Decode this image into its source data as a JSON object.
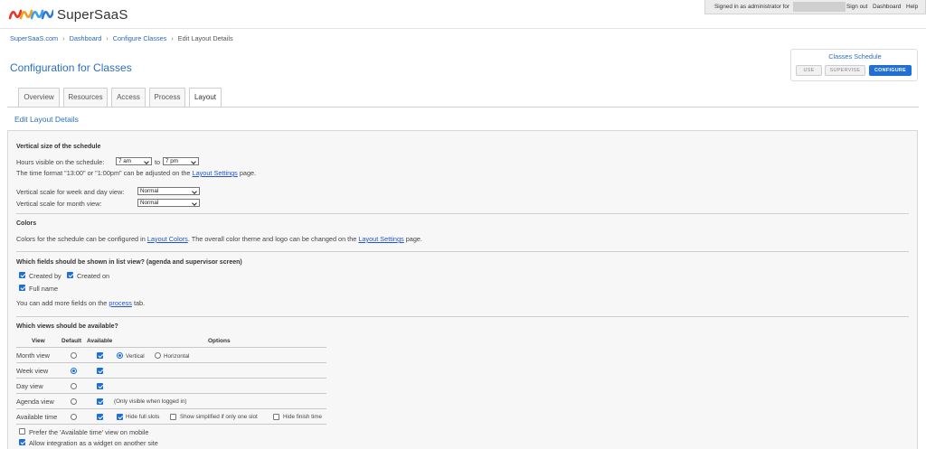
{
  "header": {
    "brand": "SuperSaaS",
    "signed_in": "Signed in as administrator for",
    "sign_out": "Sign out",
    "dashboard": "Dashboard",
    "help": "Help"
  },
  "breadcrumbs": [
    "SuperSaaS.com",
    "Dashboard",
    "Configure Classes",
    "Edit Layout Details"
  ],
  "page_title": "Configuration for Classes",
  "schedule_box": {
    "title": "Classes Schedule",
    "buttons": [
      "USE",
      "SUPERVISE",
      "CONFIGURE"
    ]
  },
  "tabs": [
    "Overview",
    "Resources",
    "Access",
    "Process",
    "Layout"
  ],
  "subheading": "Edit Layout Details",
  "vertical": {
    "heading": "Vertical size of the schedule",
    "hours_label": "Hours visible on the schedule:",
    "hours_from": "7 am",
    "hours_to_label": "to",
    "hours_to": "7 pm",
    "time_note_pre": "The time format \"13:00\" or \"1:00pm\" can be adjusted on the",
    "time_note_link": "Layout Settings",
    "time_note_post": "page.",
    "week_scale_label": "Vertical scale for week and day view:",
    "week_scale_value": "Normal",
    "month_scale_label": "Vertical scale for month view:",
    "month_scale_value": "Normal"
  },
  "colors": {
    "heading": "Colors",
    "pre": "Colors for the schedule can be configured in",
    "link1": "Layout Colors",
    "mid": ". The overall color theme and logo can be changed on the",
    "link2": "Layout Settings",
    "post": "page."
  },
  "fields": {
    "heading": "Which fields should be shown in list view? (agenda and supervisor screen)",
    "created_by": "Created by",
    "created_on": "Created on",
    "full_name": "Full name",
    "more_pre": "You can add more fields on the",
    "more_link": "process",
    "more_post": "tab."
  },
  "views": {
    "heading": "Which views should be available?",
    "columns": [
      "View",
      "Default",
      "Available",
      "Options"
    ],
    "rows": [
      {
        "name": "Month view",
        "default": false,
        "available": true
      },
      {
        "name": "Week view",
        "default": true,
        "available": true
      },
      {
        "name": "Day view",
        "default": false,
        "available": true
      },
      {
        "name": "Agenda view",
        "default": false,
        "available": true
      },
      {
        "name": "Available time",
        "default": false,
        "available": true
      }
    ],
    "month_opt_vertical": "Vertical",
    "month_opt_horizontal": "Horizontal",
    "agenda_note": "(Only visible when logged in)",
    "avail_opt1": "Hide full slots",
    "avail_opt2": "Show simplified if only one slot",
    "avail_opt3": "Hide finish time",
    "prefer_mobile": "Prefer the 'Available time' view on mobile",
    "allow_widget": "Allow integration as a widget on another site"
  },
  "colors_palette": {
    "accent": "#2b6fc2",
    "button": "#1f6fd6",
    "link": "#2255cc"
  }
}
